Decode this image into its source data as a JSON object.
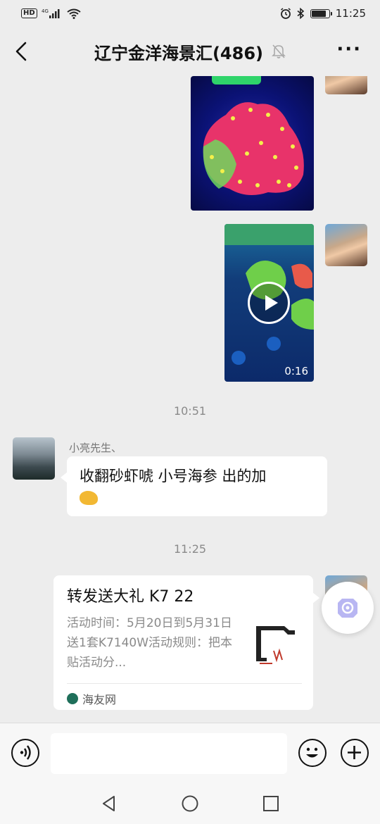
{
  "status_bar": {
    "hd_badge": "HD",
    "network": "4G",
    "time": "11:25",
    "battery_level": 0.85
  },
  "header": {
    "title": "辽宁金洋海景汇(486)",
    "back_icon": "chevron-left-icon",
    "mute_icon": "bell-off-icon",
    "more_label": "···"
  },
  "messages": {
    "video": {
      "duration": "0:16"
    },
    "time_1": "10:51",
    "sender_name": "小亮先生、",
    "text_message": "收翻砂虾唬 小号海参 出的加",
    "time_2": "11:25",
    "card": {
      "title": "转发送大礼 K7 22",
      "description": "活动时间：5月20日到5月31日送1套K7140W活动规则：把本贴活动分...",
      "source": "海友网"
    }
  },
  "input": {
    "value": "",
    "voice_icon": "voice-icon",
    "emoji_icon": "smiley-icon",
    "plus_icon": "plus-icon"
  },
  "colors": {
    "background": "#ededed",
    "bubble": "#ffffff",
    "timestamp": "#8a8a8a"
  }
}
